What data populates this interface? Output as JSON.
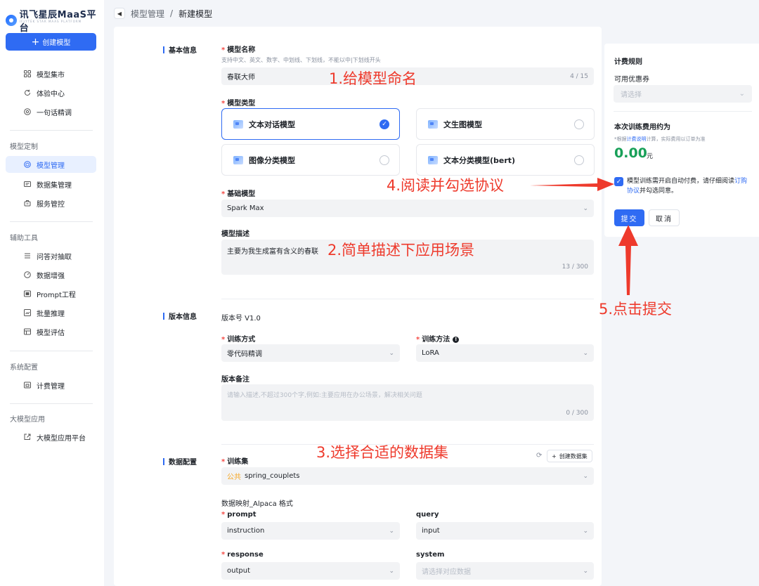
{
  "brand": {
    "name": "讯飞星辰MaaS平台",
    "sub": "IFLYTEK STAR MAAS PLATFORM"
  },
  "sidebar": {
    "create_label": "创建模型",
    "items_top": [
      {
        "label": "模型集市",
        "icon": "grid-icon"
      },
      {
        "label": "体验中心",
        "icon": "refresh-icon"
      },
      {
        "label": "一句话精调",
        "icon": "target-icon"
      }
    ],
    "groups": [
      {
        "title": "模型定制",
        "items": [
          {
            "label": "模型管理",
            "active": true
          },
          {
            "label": "数据集管理"
          },
          {
            "label": "服务管控"
          }
        ]
      },
      {
        "title": "辅助工具",
        "items": [
          {
            "label": "问答对抽取"
          },
          {
            "label": "数据增强"
          },
          {
            "label": "Prompt工程"
          },
          {
            "label": "批量推理"
          },
          {
            "label": "模型评估"
          }
        ]
      },
      {
        "title": "系统配置",
        "items": [
          {
            "label": "计费管理"
          }
        ]
      },
      {
        "title": "大模型应用",
        "items": [
          {
            "label": "大模型应用平台"
          }
        ]
      }
    ]
  },
  "header": {
    "crumb1": "模型管理",
    "sep": "/",
    "crumb2": "新建模型"
  },
  "basic": {
    "section": "基本信息",
    "name_label": "模型名称",
    "name_hint": "支持中文、英文、数字、中划线、下划线，不能以中|下划线开头",
    "name_value": "春联大师",
    "name_counter": "4 / 15",
    "type_label": "模型类型",
    "types": [
      {
        "label": "文本对话模型",
        "selected": true
      },
      {
        "label": "文生图模型",
        "selected": false
      },
      {
        "label": "图像分类模型",
        "selected": false
      },
      {
        "label": "文本分类模型(bert)",
        "selected": false
      }
    ],
    "base_label": "基础模型",
    "base_value": "Spark Max",
    "desc_label": "模型描述",
    "desc_value": "主要为我生成富有含义的春联",
    "desc_counter": "13 / 300"
  },
  "version": {
    "section": "版本信息",
    "version_text": "版本号  V1.0",
    "train_mode_label": "训练方式",
    "train_mode_value": "零代码精调",
    "train_method_label": "训练方法",
    "train_method_value": "LoRA",
    "note_label": "版本备注",
    "note_placeholder": "请输入描述,不超过300个字,例如:主要应用在办公场景，解决相关问题",
    "note_counter": "0 / 300"
  },
  "data": {
    "section": "数据配置",
    "train_label": "训练集",
    "create_dataset": "创建数据集",
    "dataset_tag": "公共",
    "dataset_value": "spring_couplets",
    "mapping_title": "数据映射_Alpaca 格式",
    "prompt_label": "prompt",
    "prompt_value": "instruction",
    "query_label": "query",
    "query_value": "input",
    "response_label": "response",
    "response_value": "output",
    "system_label": "system",
    "system_placeholder": "请选择对应数据"
  },
  "billing": {
    "title": "计费规则",
    "coupon_label": "可用优惠券",
    "coupon_placeholder": "请选择",
    "cost_label": "本次训练费用约为",
    "note_prefix": "*根据",
    "note_link": "计费说明",
    "note_suffix": "计算，实际费用以订单为准",
    "cost_value": "0.00",
    "cost_unit": "元",
    "agree_text": "模型训练需开启自动付费，请仔细阅读",
    "agree_link": "订购协议",
    "agree_suffix": "并勾选同意。",
    "submit": "提交",
    "cancel": "取消"
  },
  "annotations": {
    "a1": "1.给模型命名",
    "a2": "2.简单描述下应用场景",
    "a3": "3.选择合适的数据集",
    "a4": "4.阅读并勾选协议",
    "a5": "5.点击提交"
  },
  "colors": {
    "accent": "#2f6bf3",
    "annotation": "#ee3a2c",
    "cost": "#18a058"
  }
}
